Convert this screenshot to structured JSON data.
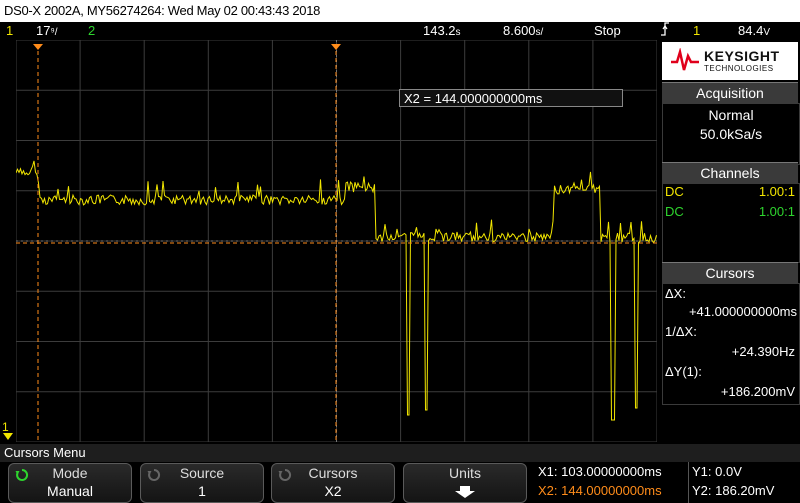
{
  "title_bar": {
    "text": "DS0-X 2002A, MY56274264: Wed May 02 00:43:43 2018"
  },
  "status": {
    "ch1_num": "1",
    "ch1_scale": "17३/",
    "ch1_scale_text": "17⁠",
    "ch2_num": "2",
    "time_delay": "143.2ș",
    "time_delay_text": "143.2",
    "time_delay_unit": "s",
    "time_scale": "8.600",
    "time_scale_unit": "s/",
    "run_state": "Stop",
    "trigger_icon": "trigger-edge-icon",
    "trigger_channel": "1",
    "trigger_level": "84.4",
    "trigger_level_unit": "V"
  },
  "cursor_box": {
    "text": "X2 = 144.000000000ms"
  },
  "brand": {
    "name": "KEYSIGHT",
    "sub": "TECHNOLOGIES",
    "color": "#e0001b"
  },
  "acquisition": {
    "header": "Acquisition",
    "mode": "Normal",
    "rate": "50.0kSa/s"
  },
  "channels": {
    "header": "Channels",
    "rows": [
      {
        "coupling": "DC",
        "probe": "1.00:1",
        "color": "#f2e600"
      },
      {
        "coupling": "DC",
        "probe": "1.00:1",
        "color": "#2ed52e"
      }
    ]
  },
  "cursors": {
    "header": "Cursors",
    "dx_label": "ΔX:",
    "dx_value": "+41.000000000ms",
    "inv_dx_label": "1/ΔX:",
    "inv_dx_value": "+24.390Hz",
    "dy_label": "ΔY(1):",
    "dy_value": "+186.200mV"
  },
  "menu": {
    "title": "Cursors Menu"
  },
  "softkeys": [
    {
      "top": "Mode",
      "bottom": "Manual"
    },
    {
      "top": "Source",
      "bottom": "1"
    },
    {
      "top": "Cursors",
      "bottom": "X2"
    },
    {
      "top": "Units",
      "bottom": ""
    }
  ],
  "readout": {
    "x1": "X1: 103.00000000ms",
    "x2": "X2: 144.00000000ms",
    "y1": "Y1: 0.0V",
    "y2": "Y2: 186.20mV"
  },
  "ground_marker": "1",
  "colors": {
    "ch1": "#f2e600",
    "ch2": "#2ed52e",
    "cursor": "#ff8c1a",
    "grid": "#3c3c3c"
  }
}
